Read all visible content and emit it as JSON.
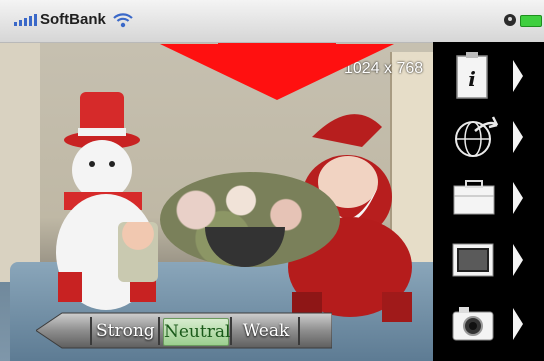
{
  "status_bar": {
    "carrier": "SoftBank",
    "signal_icon": "signal-bars-icon",
    "wifi_icon": "wifi-icon",
    "clock_icon": "clock-icon",
    "battery_icon": "battery-icon"
  },
  "viewfinder": {
    "resolution": "1024 x 768"
  },
  "exposure": {
    "options": [
      "Strong",
      "Neutral",
      "Weak"
    ],
    "selected": "Neutral",
    "back_icon": "arrow-left-icon"
  },
  "toolbar": {
    "buttons": [
      {
        "icon": "info-icon"
      },
      {
        "icon": "globe-share-icon"
      },
      {
        "icon": "briefcase-icon"
      },
      {
        "icon": "film-strip-icon"
      },
      {
        "icon": "camera-icon"
      }
    ]
  },
  "colors": {
    "arrow": "#ff1010",
    "selected_option": "#9ccf8f",
    "toolbar_bg": "#000000"
  }
}
